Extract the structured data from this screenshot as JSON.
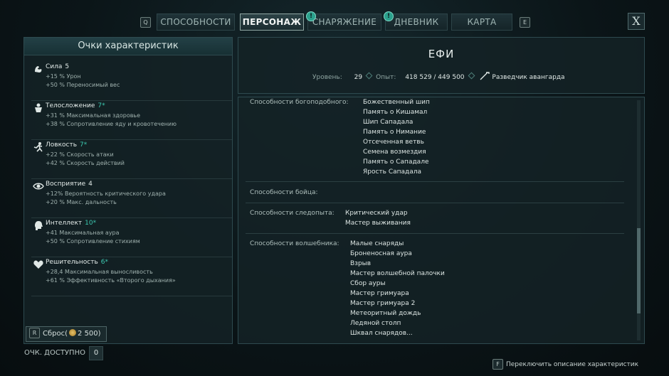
{
  "nav": {
    "left_key": "Q",
    "right_key": "E",
    "tabs": [
      {
        "label": "СПОСОБНОСТИ",
        "active": false,
        "alert": false
      },
      {
        "label": "ПЕРСОНАЖ",
        "active": true,
        "alert": false
      },
      {
        "label": "СНАРЯЖЕНИЕ",
        "active": false,
        "alert": true
      },
      {
        "label": "ДНЕВНИК",
        "active": false,
        "alert": true
      },
      {
        "label": "КАРТА",
        "active": false,
        "alert": false
      }
    ],
    "alert_mark": "!",
    "close_label": "X"
  },
  "attributes": {
    "title": "Очки характеристик",
    "stats": [
      {
        "name": "Сила",
        "value": "5",
        "bonus": false,
        "line1": "+15 % Урон",
        "line2": "+50 % Переносимый вес",
        "icon": "arm-icon"
      },
      {
        "name": "Телосложение",
        "value": "7*",
        "bonus": true,
        "line1": "+31 % Максимальная здоровье",
        "line2": "+38 % Сопротивление яду и кровотечению",
        "icon": "body-icon"
      },
      {
        "name": "Ловкость",
        "value": "7*",
        "bonus": true,
        "line1": "+22 % Скорость атаки",
        "line2": "+42 % Скорость действий",
        "icon": "runner-icon"
      },
      {
        "name": "Восприятие",
        "value": "4",
        "bonus": false,
        "line1": "+12% Вероятность критического удара",
        "line2": "+20 % Макс. дальность",
        "icon": "eye-icon"
      },
      {
        "name": "Интеллект",
        "value": "10*",
        "bonus": true,
        "line1": "+41 Максимальная аура",
        "line2": "+50 % Сопротивление стихиям",
        "icon": "head-icon"
      },
      {
        "name": "Решительность",
        "value": "6*",
        "bonus": true,
        "line1": "+28,4 Максимальная выносливость",
        "line2": "+61 % Эффективность «Второго дыхания»",
        "icon": "heart-icon"
      }
    ],
    "reset_key": "R",
    "reset_label": "Сброс",
    "reset_cost_open": "(",
    "reset_cost": "2 500",
    "reset_cost_close": ")",
    "points_label": "ОЧК. ДОСТУПНО",
    "points_value": "0"
  },
  "character": {
    "name": "ЕФИ",
    "level_label": "Уровень:",
    "level": "29",
    "exp_label": "Опыт:",
    "exp": "418 529 / 449 500",
    "class": "Разведчик авангарда"
  },
  "abilities": {
    "godlike_label": "Способности богоподобного:",
    "godlike": [
      "Божественный шип",
      "Память о Кишамал",
      "Шип Сападала",
      "Память о Нимание",
      "Отсеченная ветвь",
      "Семена возмездия",
      "Память о Сападале",
      "Ярость Сападала"
    ],
    "fighter_label": "Способности бойца:",
    "ranger_label": "Способности следопыта:",
    "ranger": [
      "Критический удар",
      "Мастер выживания"
    ],
    "wizard_label": "Способности волшебника:",
    "wizard": [
      "Малые снаряды",
      "Броненосная аура",
      "Взрыв",
      "Мастер волшебной палочки",
      "Сбор ауры",
      "Мастер гримуара",
      "Мастер гримуара 2",
      "Метеоритный дождь",
      "Ледяной столп",
      "Шквал снарядов..."
    ]
  },
  "footer": {
    "toggle_key": "F",
    "toggle_label": "Переключить описание характеристик"
  }
}
